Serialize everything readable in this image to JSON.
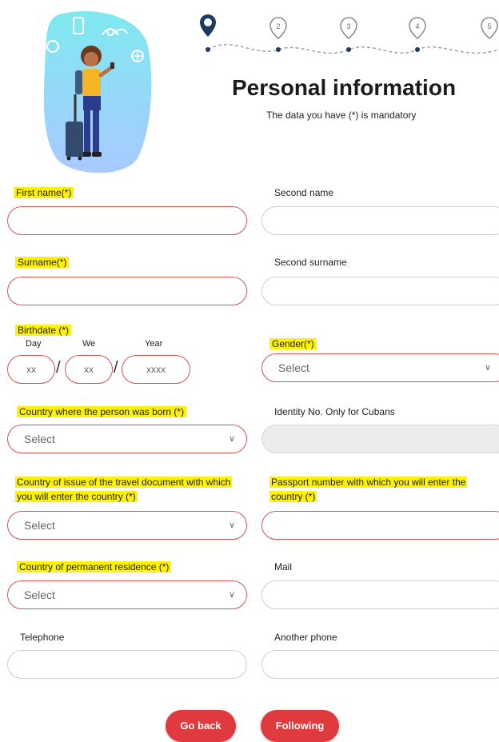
{
  "header": {
    "title": "Personal information",
    "subtitle": "The data you have (*) is mandatory"
  },
  "stepper": {
    "steps": [
      "2",
      "3",
      "4",
      "5"
    ]
  },
  "colors": {
    "accent_red": "#e03a3e",
    "highlight": "#fff200",
    "stepper_blue": "#1f3a5f"
  },
  "form": {
    "first_name": {
      "label": "First name(*)",
      "value": ""
    },
    "second_name": {
      "label": "Second name",
      "value": ""
    },
    "surname": {
      "label": "Surname(*)",
      "value": ""
    },
    "second_surname": {
      "label": "Second surname",
      "value": ""
    },
    "birthdate": {
      "label": "Birthdate (*)",
      "day_label": "Day",
      "month_label": "We",
      "year_label": "Year",
      "day_placeholder": "xx",
      "month_placeholder": "xx",
      "year_placeholder": "xxxx",
      "separator": "/"
    },
    "gender": {
      "label": "Gender(*)",
      "selected": "Select"
    },
    "birth_country": {
      "label": "Country where the person was born (*)",
      "selected": "Select"
    },
    "identity_no": {
      "label": "Identity No. Only for Cubans",
      "value": ""
    },
    "issue_country": {
      "label": "Country of issue of the travel document with which you will enter the country (*)",
      "selected": "Select"
    },
    "passport": {
      "label": "Passport number with which you will enter the country (*)",
      "value": ""
    },
    "residence_country": {
      "label": "Country of permanent residence (*)",
      "selected": "Select"
    },
    "mail": {
      "label": "Mail",
      "value": ""
    },
    "telephone": {
      "label": "Telephone",
      "value": ""
    },
    "another_phone": {
      "label": "Another phone",
      "value": ""
    }
  },
  "buttons": {
    "back": "Go back",
    "next": "Following"
  }
}
